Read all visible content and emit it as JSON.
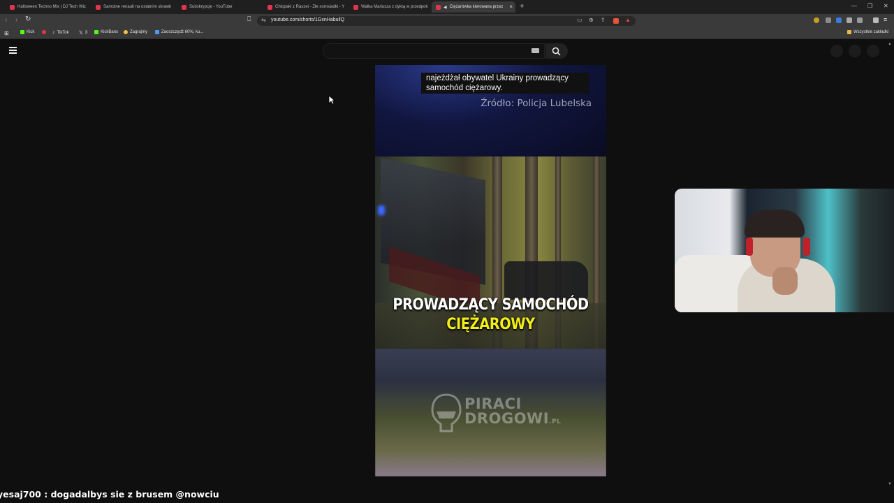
{
  "browser": {
    "tabs": [
      {
        "title": "Halloween Techno Mix | DJ Tech Wiz",
        "active": false
      },
      {
        "title": "Samotne renault na ostatnim skrawk",
        "active": false
      },
      {
        "title": "Subskrypcje - YouTube",
        "active": false
      },
      {
        "title": "Chłopaki z Raszei - Złe somsiadki - Y",
        "active": false
      },
      {
        "title": "Walka Mariusza z dyktą w przedpok",
        "active": false
      },
      {
        "title": "Ciężarówka kierowana przez",
        "active": true
      }
    ],
    "new_tab": "+",
    "close_tab": "×",
    "url": "youtube.com/shorts/1GxnHabullQ",
    "bookmarks": [
      {
        "label": "Kick",
        "color": "#53fc18"
      },
      {
        "label": "",
        "color": "#e4344d"
      },
      {
        "label": "TikTok",
        "color": "#ffffff"
      },
      {
        "label": "X",
        "color": "#ffffff"
      },
      {
        "label": "KickBans",
        "color": "#53fc18"
      },
      {
        "label": "Zagrajmy",
        "color": "#f0c040"
      },
      {
        "label": "Zaoszczędź 60%, ku...",
        "color": "#4a9bff"
      }
    ],
    "all_bookmarks": "Wszystkie zakładki"
  },
  "video": {
    "caption": "najeżdżał obywatel Ukrainy prowadzący samochód ciężarowy.",
    "source": "Źródło: Policja Lubelska",
    "headline_line1": "PROWADZĄCY SAMOCHÓD",
    "headline_line2": "CIĘŻAROWY",
    "watermark_line1": "PIRACI",
    "watermark_line2": "DROGOWI",
    "watermark_suffix": ".PL"
  },
  "chat": {
    "username": "yesaj700",
    "separator": " : ",
    "message": "dogadalbys sie z brusem @nowciu"
  },
  "colors": {
    "page_bg": "#0f0f0f",
    "headline_accent": "#f2ee1a",
    "tab_favicon": "#e4344d"
  }
}
